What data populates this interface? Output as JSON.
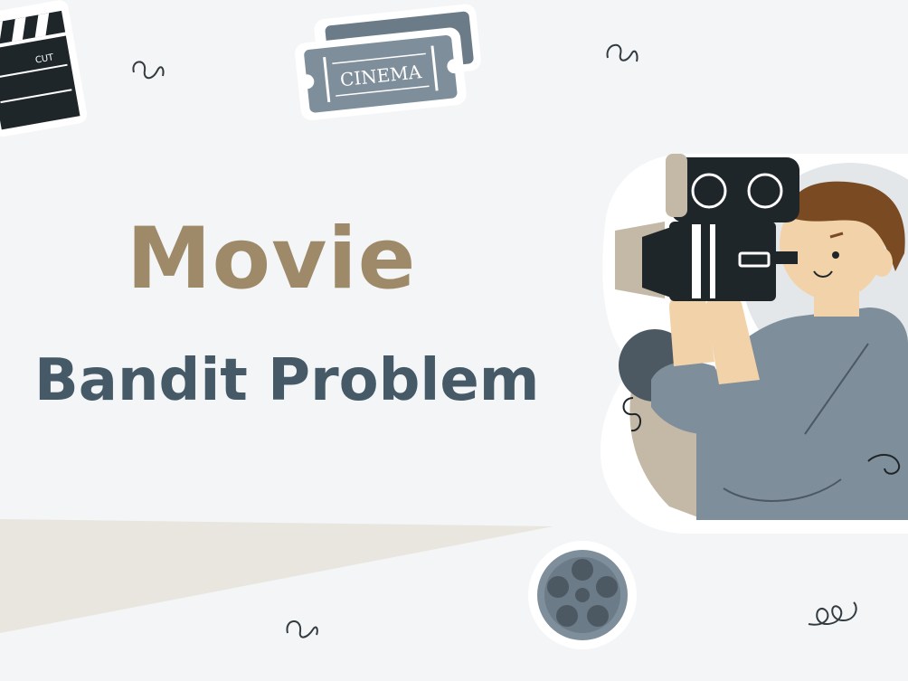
{
  "title": {
    "line1": "Movie",
    "line2": "Bandit Problem"
  },
  "stickers": {
    "ticket_text": "CINEMA",
    "clapper_text": "CUT"
  },
  "colors": {
    "background": "#f3f5f6",
    "title_gold": "#9e8a68",
    "title_slate": "#455966",
    "sticker_gray": "#7f8e9b",
    "dark": "#1f2629",
    "beige": "#c4b8a6"
  },
  "icons": [
    "clapperboard-icon",
    "cinema-ticket-icon",
    "film-reel-icon",
    "camera-operator-illustration",
    "squiggle-icon"
  ]
}
